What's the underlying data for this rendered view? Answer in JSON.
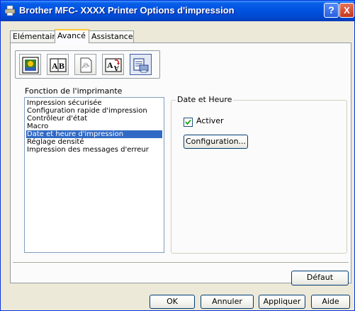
{
  "window": {
    "title": "Brother MFC- XXXX    Printer Options d'impression",
    "help_glyph": "?",
    "close_glyph": "X"
  },
  "tabs": [
    {
      "label": "Elémentaire"
    },
    {
      "label": "Avancé",
      "active": true
    },
    {
      "label": "Assistance"
    }
  ],
  "feature_list": {
    "label": "Fonction de l'imprimante",
    "items": [
      "Impression sécurisée",
      "Configuration rapide d'impression",
      "Contrôleur d'état",
      "Macro",
      "Date et heure d'impression",
      "Réglage densité",
      "Impression des messages d'erreur"
    ],
    "selected_index": 4
  },
  "date_group": {
    "title": "Date et Heure",
    "activer_label": "Activer",
    "activer_checked": true,
    "configuration_label": "Configuration..."
  },
  "buttons": {
    "defaut": "Défaut",
    "ok": "OK",
    "annuler": "Annuler",
    "appliquer": "Appliquer",
    "aide": "Aide"
  },
  "colors": {
    "titlebar": "#0054e3",
    "selection": "#316ac5",
    "dialog_bg": "#ece9d8"
  }
}
